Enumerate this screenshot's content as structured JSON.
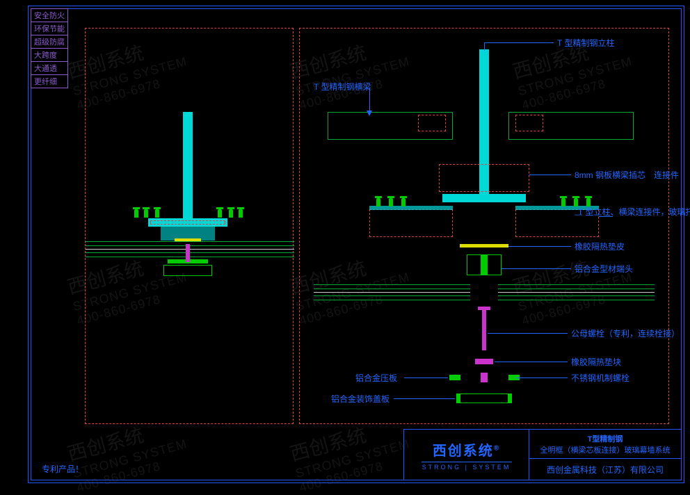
{
  "tags": [
    "安全防火",
    "环保节能",
    "超级防腐",
    "大跨度",
    "大通透",
    "更纤细"
  ],
  "labels": {
    "r_post": "T 型精制钢立柱",
    "r_beam": "T 型精制钢横梁",
    "r_core": "8mm 钢板横梁插芯　连接件",
    "r_bracket": "T 型立柱、横梁连接件，玻璃托板",
    "r_rubber_pad": "橡胶隔热垫皮",
    "r_alu_end": "铝合金型材端头",
    "r_bolt": "公母螺栓（专利，连续栓接）",
    "r_rubber_block": "橡胶隔热垫块",
    "r_press": "铝合金压板",
    "r_ss_bolt": "不锈钢机制螺栓",
    "r_cover": "铝合金装饰盖板"
  },
  "footer": {
    "patent": "专利产品！",
    "brand": "西创系统",
    "brand_mark": "®",
    "brand_sub": "STRONG | SYSTEM",
    "title1": "T型精制钢",
    "title2": "全明框（横梁芯板连接）玻璃幕墙系统",
    "company": "西创金属科技（江苏）有限公司"
  },
  "watermark": {
    "line1": "西创系统",
    "line2": "STRONG SYSTEM",
    "line3": "400-860-6978"
  }
}
